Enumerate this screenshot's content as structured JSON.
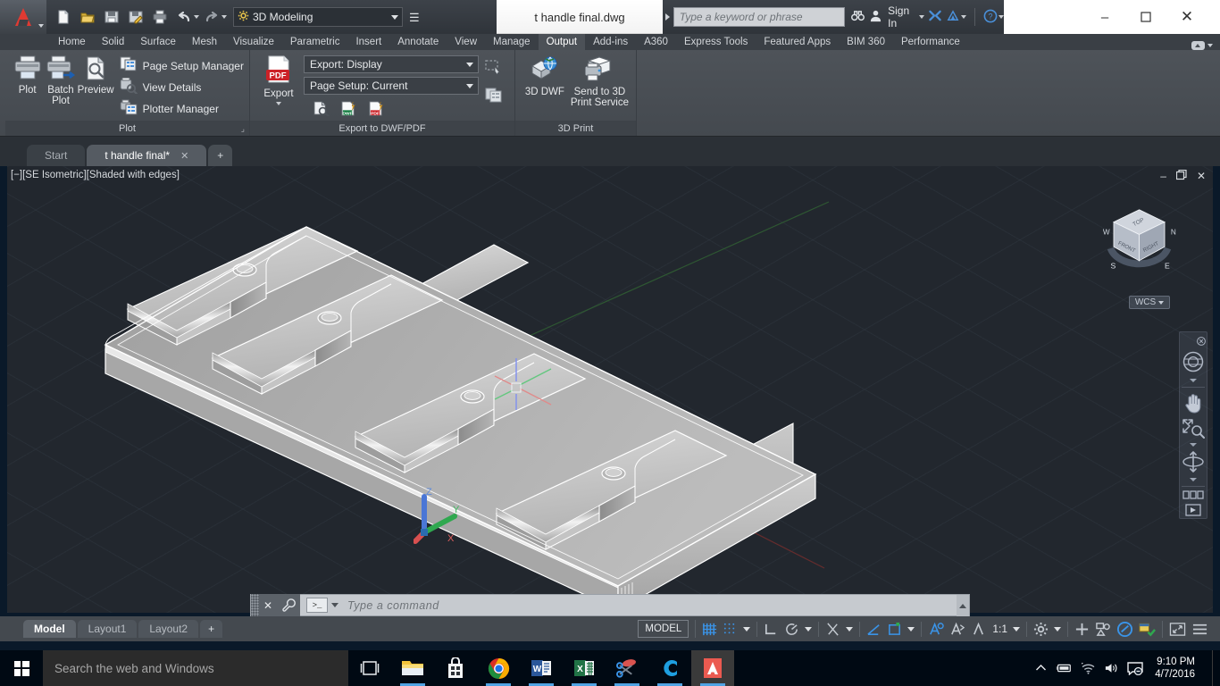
{
  "window": {
    "title": "t handle final.dwg",
    "minimize": "–",
    "maximize": "❐",
    "close": "✕"
  },
  "quick_access": {
    "workspace": "3D Modeling",
    "icons": [
      "new-icon",
      "open-icon",
      "save-icon",
      "saveas-icon",
      "plot-icon",
      "undo-icon",
      "redo-icon"
    ],
    "more_label": "☰"
  },
  "infocenter": {
    "search_placeholder": "Type a keyword or phrase",
    "sign_in": "Sign In",
    "help": "?"
  },
  "ribbon": {
    "tabs": [
      {
        "label": "Home",
        "active": false
      },
      {
        "label": "Solid",
        "active": false
      },
      {
        "label": "Surface",
        "active": false
      },
      {
        "label": "Mesh",
        "active": false
      },
      {
        "label": "Visualize",
        "active": false
      },
      {
        "label": "Parametric",
        "active": false
      },
      {
        "label": "Insert",
        "active": false
      },
      {
        "label": "Annotate",
        "active": false
      },
      {
        "label": "View",
        "active": false
      },
      {
        "label": "Manage",
        "active": false
      },
      {
        "label": "Output",
        "active": true
      },
      {
        "label": "Add-ins",
        "active": false
      },
      {
        "label": "A360",
        "active": false
      },
      {
        "label": "Express Tools",
        "active": false
      },
      {
        "label": "Featured Apps",
        "active": false
      },
      {
        "label": "BIM 360",
        "active": false
      },
      {
        "label": "Performance",
        "active": false
      }
    ],
    "panels": [
      {
        "title": "Plot",
        "big_buttons": [
          {
            "label": "Plot",
            "icon": "printer-icon"
          },
          {
            "label": "Batch Plot",
            "icon": "batch-plot-icon"
          },
          {
            "label": "Preview",
            "icon": "preview-icon"
          }
        ],
        "small_buttons": [
          {
            "label": "Page Setup Manager",
            "icon": "page-setup-manager-icon"
          },
          {
            "label": "View Details",
            "icon": "view-details-icon"
          },
          {
            "label": "Plotter Manager",
            "icon": "plotter-manager-icon"
          }
        ]
      },
      {
        "title": "Export to DWF/PDF",
        "big_buttons": [
          {
            "label": "Export",
            "icon": "pdf-export-icon"
          }
        ],
        "combos": [
          {
            "label": "Export: Display"
          },
          {
            "label": "Page Setup: Current"
          }
        ],
        "tiny_buttons": [
          {
            "icon": "preview-small-icon"
          },
          {
            "icon": "export-dwf-icon"
          },
          {
            "icon": "export-pdf-icon"
          }
        ],
        "side_buttons": [
          {
            "icon": "export-window-icon"
          },
          {
            "icon": "page-setup-small-icon"
          }
        ]
      },
      {
        "title": "3D Print",
        "big_buttons": [
          {
            "label": "3D DWF",
            "icon": "3d-dwf-icon"
          },
          {
            "label": "Send to 3D Print Service",
            "icon": "3d-print-icon"
          }
        ]
      }
    ]
  },
  "file_tabs": [
    {
      "label": "Start",
      "active": false,
      "closable": false
    },
    {
      "label": "t handle final*",
      "active": true,
      "closable": true
    }
  ],
  "file_tab_add": "+",
  "viewport": {
    "label": "[−][SE Isometric][Shaded with edges]",
    "controls": {
      "minimize": "–",
      "restore": "❐",
      "close": "✕"
    },
    "ucs_axes": [
      "Z",
      "Y",
      "X"
    ],
    "viewcube": {
      "top": "TOP",
      "front": "FRONT",
      "right": "RIGHT",
      "compass": [
        "N",
        "E",
        "S",
        "W"
      ]
    },
    "wcs_label": "WCS",
    "navbar_items": [
      "steering-wheel-icon",
      "pan-hand-icon",
      "zoom-extents-icon",
      "orbit-icon",
      "showmotion-icon"
    ],
    "model_description": "T-handle extrusion solid, shaded with edges"
  },
  "command_line": {
    "placeholder": "Type a command",
    "prompt": ">_",
    "close": "✕",
    "wrench": "customize-icon"
  },
  "status_bar": {
    "layout_tabs": [
      {
        "label": "Model",
        "active": true
      },
      {
        "label": "Layout1",
        "active": false
      },
      {
        "label": "Layout2",
        "active": false
      }
    ],
    "layout_add": "+",
    "space_toggle": "MODEL",
    "scale": "1:1",
    "items": [
      "grid-display-icon",
      "snap-mode-icon",
      "ortho-icon",
      "polar-tracking-icon",
      "isometric-drafting-icon",
      "object-snap-tracking-icon",
      "object-snap-icon",
      "lineweight-icon",
      "transparency-icon",
      "selection-cycling-icon",
      "annotation-visibility-icon",
      "annotation-scale-icon",
      "workspace-switch-icon",
      "hardware-acceleration-icon",
      "isolate-objects-icon",
      "clean-screen-icon",
      "customization-icon"
    ]
  },
  "taskbar": {
    "search_placeholder": "Search the web and Windows",
    "start_icon": "windows-start-icon",
    "apps": [
      {
        "name": "task-view-icon",
        "running": false
      },
      {
        "name": "file-explorer-icon",
        "running": true
      },
      {
        "name": "windows-store-icon",
        "running": false
      },
      {
        "name": "google-chrome-icon",
        "running": true
      },
      {
        "name": "microsoft-word-icon",
        "running": true
      },
      {
        "name": "microsoft-excel-icon",
        "running": true
      },
      {
        "name": "snipping-tool-icon",
        "running": true
      },
      {
        "name": "creo-icon",
        "running": true
      },
      {
        "name": "autocad-icon",
        "running": true,
        "active": true
      }
    ],
    "tray": [
      "show-hidden-icons-icon",
      "battery-icon",
      "wifi-icon",
      "volume-icon",
      "action-center-icon"
    ],
    "time": "9:10 PM",
    "date": "4/7/2016"
  },
  "colors": {
    "accent_red": "#e03a32",
    "ribbon_bg": "#4a4f55",
    "viewport_bg": "#22272e",
    "taskbar_bg": "#000913",
    "status_bg": "#44494f",
    "cmd_bg": "#c6cacf"
  }
}
